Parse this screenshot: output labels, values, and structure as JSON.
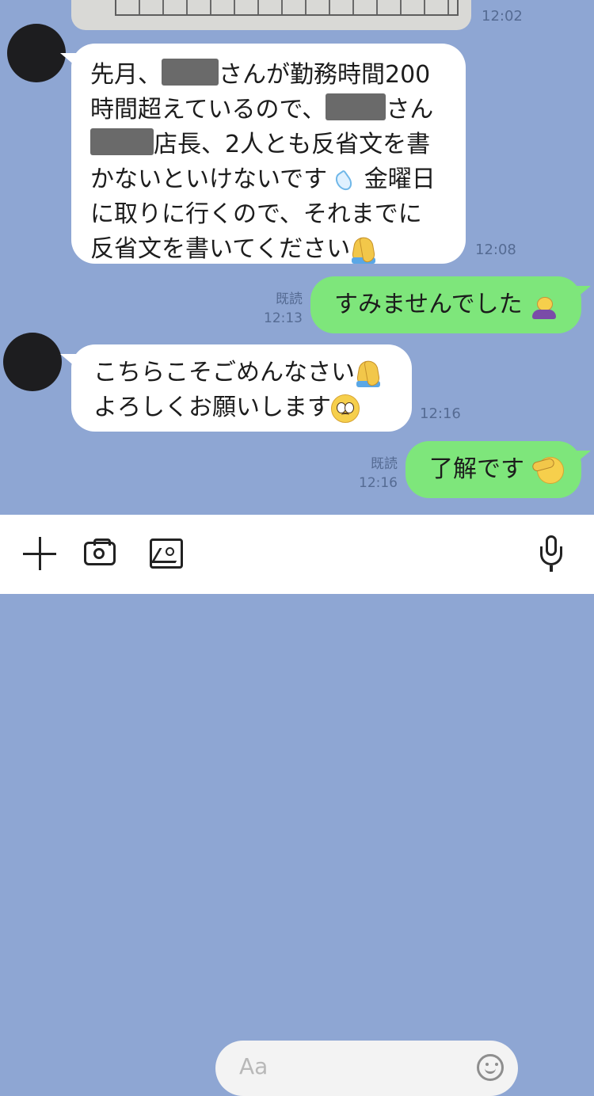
{
  "chat": {
    "top_image_time": "12:02",
    "messages": [
      {
        "lines": [
          "先月、",
          "さんが勤務時間200",
          "時間超えているので、",
          "さん",
          "店長、2人とも反省文を書",
          "かないといけないです",
          "金曜日",
          "に取りに行くので、それまでに",
          "反省文を書いてください"
        ],
        "time": "12:08"
      },
      {
        "text": "すみませんでした",
        "read_label": "既読",
        "time": "12:13"
      },
      {
        "line1": "こちらこそごめんなさい",
        "line2": "よろしくお願いします",
        "time": "12:16"
      },
      {
        "text": "了解です",
        "read_label": "既読",
        "time": "12:16"
      }
    ]
  },
  "input": {
    "placeholder": "Aa"
  },
  "icons": {
    "plus": "plus-icon",
    "camera": "camera-icon",
    "image": "image-icon",
    "emoji": "smile-icon",
    "mic": "microphone-icon"
  },
  "colors": {
    "chat_background": "#8ea6d3",
    "outgoing_bubble": "#7ee67b",
    "incoming_bubble": "#ffffff"
  }
}
